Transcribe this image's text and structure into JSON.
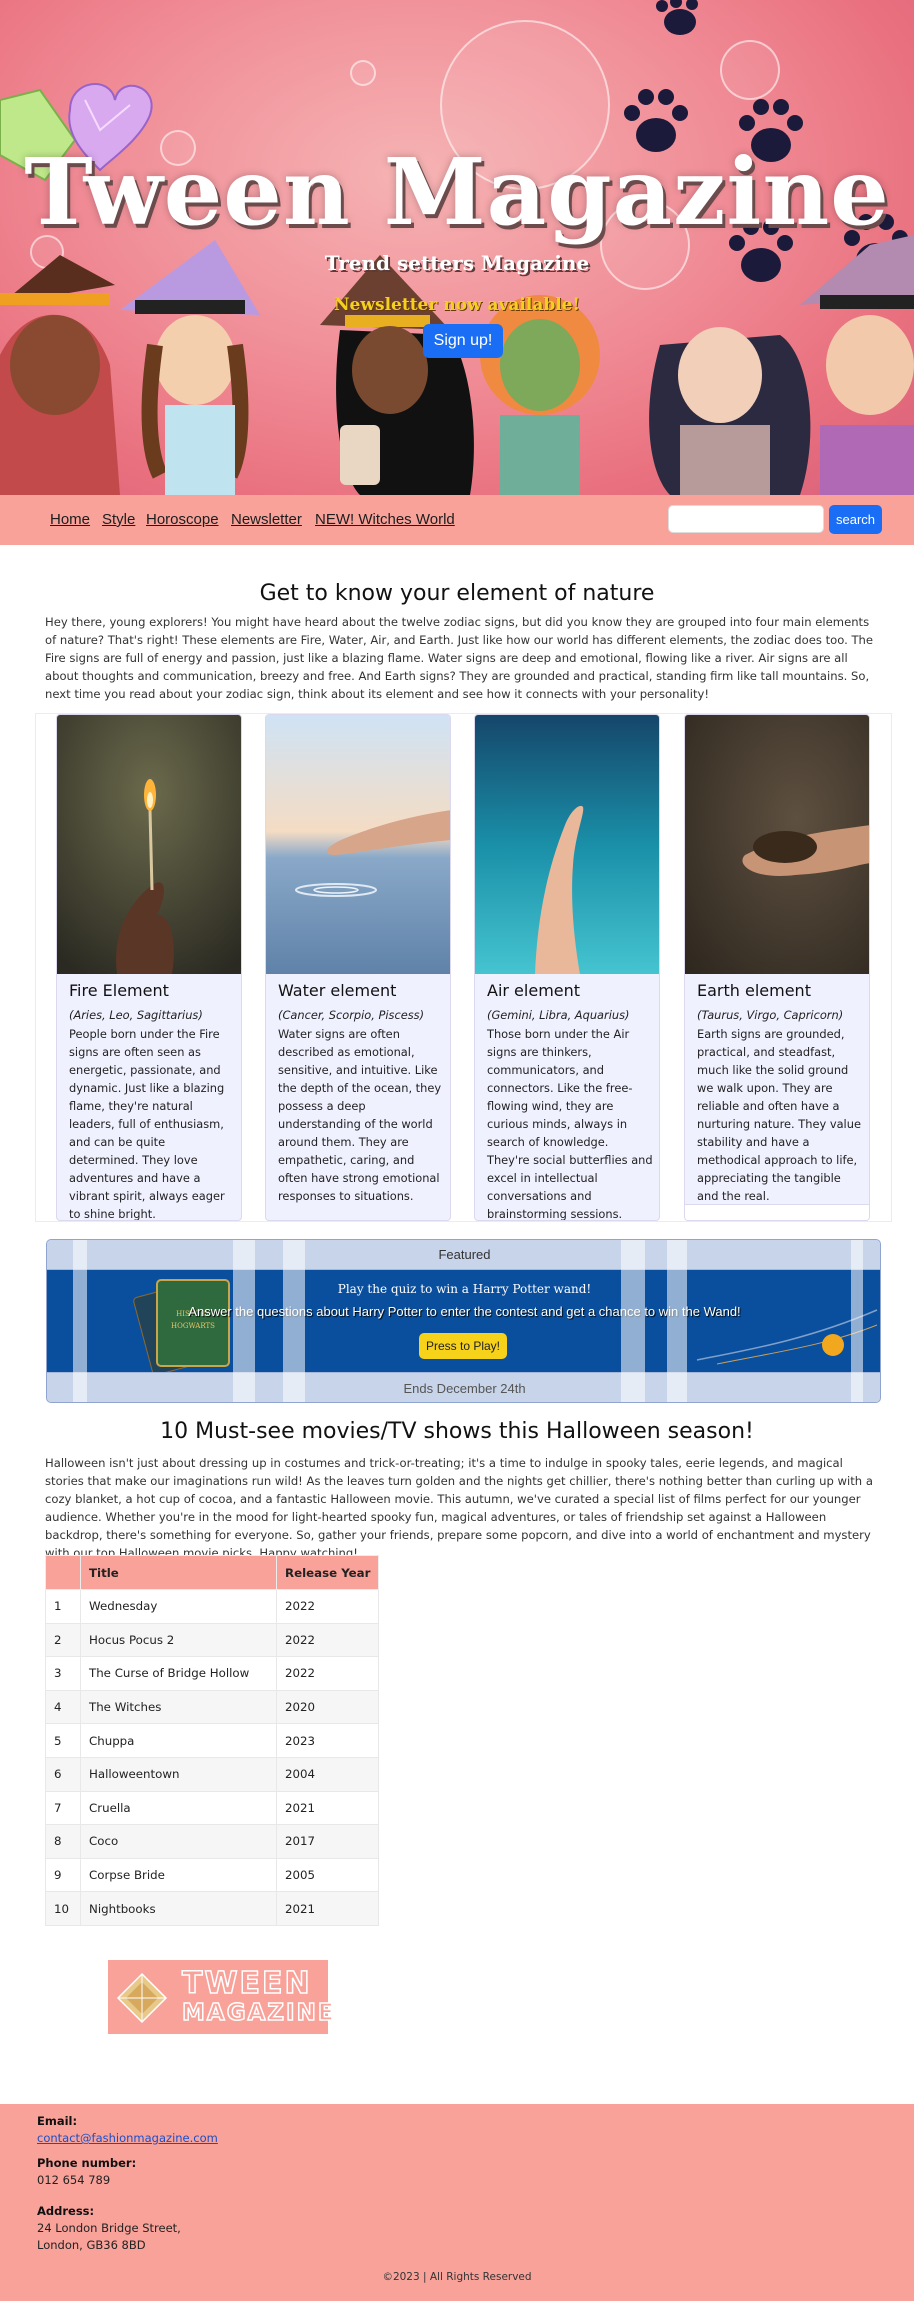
{
  "hero": {
    "title": "Tween Magazine",
    "subtitle": "Trend setters Magazine",
    "newsletter_text": "Newsletter now available!",
    "signup_label": "Sign up!"
  },
  "nav": {
    "links": [
      "Home",
      "Style",
      "Horoscope",
      "Newsletter",
      "NEW! Witches World"
    ],
    "search_placeholder": "",
    "search_label": "search"
  },
  "elements": {
    "heading": "Get to know your element of nature",
    "intro": "Hey there, young explorers! You might have heard about the twelve zodiac signs, but did you know they are grouped into four main elements of nature? That's right! These elements are Fire, Water, Air, and Earth. Just like how our world has different elements, the zodiac does too. The Fire signs are full of energy and passion, just like a blazing flame. Water signs are deep and emotional, flowing like a river. Air signs are all about thoughts and communication, breezy and free. And Earth signs? They are grounded and practical, standing firm like tall mountains. So, next time you read about your zodiac sign, think about its element and see how it connects with your personality!",
    "cards": [
      {
        "title": "Fire Element",
        "signs": "(Aries, Leo, Sagittarius)",
        "text": "People born under the Fire signs are often seen as energetic, passionate, and dynamic. Just like a blazing flame, they're natural leaders, full of enthusiasm, and can be quite determined. They love adventures and have a vibrant spirit, always eager to shine bright."
      },
      {
        "title": "Water element",
        "signs": "(Cancer, Scorpio, Piscess)",
        "text": "Water signs are often described as emotional, sensitive, and intuitive. Like the depth of the ocean, they possess a deep understanding of the world around them. They are empathetic, caring, and often have strong emotional responses to situations."
      },
      {
        "title": "Air element",
        "signs": "(Gemini, Libra, Aquarius)",
        "text": "Those born under the Air signs are thinkers, communicators, and connectors. Like the free-flowing wind, they are curious minds, always in search of knowledge. They're social butterflies and excel in intellectual conversations and brainstorming sessions."
      },
      {
        "title": "Earth element",
        "signs": "(Taurus, Virgo, Capricorn)",
        "text": "Earth signs are grounded, practical, and steadfast, much like the solid ground we walk upon. They are reliable and often have a nurturing nature. They value stability and have a methodical approach to life, appreciating the tangible and the real."
      }
    ]
  },
  "featured": {
    "header": "Featured",
    "quiz_title": "Play the quiz to win a Harry Potter wand!",
    "quiz_text": "Answer the questions about Harry Potter to enter the contest and get a chance to win the Wand!",
    "button_label": "Press to Play!",
    "footer": "Ends December 24th",
    "book_text": [
      "HISTORY",
      "HOGWARTS"
    ]
  },
  "movies": {
    "heading": "10 Must-see movies/TV shows this Halloween season!",
    "intro": "Halloween isn't just about dressing up in costumes and trick-or-treating; it's a time to indulge in spooky tales, eerie legends, and magical stories that make our imaginations run wild! As the leaves turn golden and the nights get chillier, there's nothing better than curling up with a cozy blanket, a hot cup of cocoa, and a fantastic Halloween movie. This autumn, we've curated a special list of films perfect for our younger audience. Whether you're in the mood for light-hearted spooky fun, magical adventures, or tales of friendship set against a Halloween backdrop, there's something for everyone. So, gather your friends, prepare some popcorn, and dive into a world of enchantment and mystery with our top Halloween movie picks. Happy watching!",
    "columns": [
      "",
      "Title",
      "Release Year"
    ],
    "rows": [
      [
        "1",
        "Wednesday",
        "2022"
      ],
      [
        "2",
        "Hocus Pocus 2",
        "2022"
      ],
      [
        "3",
        "The Curse of Bridge Hollow",
        "2022"
      ],
      [
        "4",
        "The Witches",
        "2020"
      ],
      [
        "5",
        "Chuppa",
        "2023"
      ],
      [
        "6",
        "Halloweentown",
        "2004"
      ],
      [
        "7",
        "Cruella",
        "2021"
      ],
      [
        "8",
        "Coco",
        "2017"
      ],
      [
        "9",
        "Corpse Bride",
        "2005"
      ],
      [
        "10",
        "Nightbooks",
        "2021"
      ]
    ]
  },
  "logo": {
    "line1": "TWEEN",
    "line2": "MAGAZINE"
  },
  "footer": {
    "email_label": "Email:",
    "email": "contact@fashionmagazine.com",
    "phone_label": "Phone number:",
    "phone": "012 654 789",
    "address_label": "Address:",
    "address_line1": "24 London Bridge Street,",
    "address_line2": "London, GB36 8BD",
    "copyright": "©2023 | All Rights Reserved"
  },
  "colors": {
    "accent": "#f8a29a",
    "button_blue": "#1a6ef5",
    "card_bg": "#f0f1ff",
    "featured_blue": "#0a4f9e",
    "play_yellow": "#f7d21a"
  }
}
